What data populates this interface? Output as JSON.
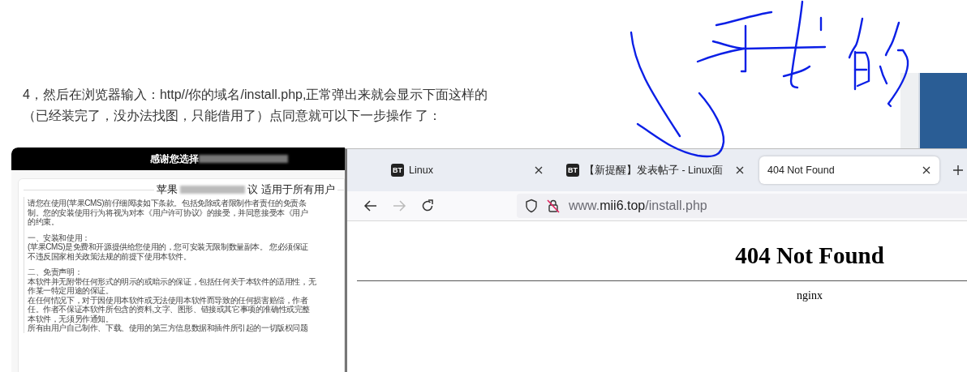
{
  "article": {
    "paragraph_lines": [
      "4，然后在浏览器输入：http//你的域名/install.php,正常弹出来就会显示下面这样的",
      "（已经装完了，没办法找图，只能借用了）点同意就可以下一步操作 了："
    ]
  },
  "embedded_screenshot": {
    "header_text": "感谢您选择",
    "title_start": "苹果",
    "title_end": "议 适用于所有用户",
    "body_blocks": [
      {
        "lines": [
          "请您在使用(苹果CMS)前仔细阅读如下条款。包括免除或者限制作者责任的免责条",
          "制。您的安装使用行为将视为对本《用户许可协议》的接受，并同意接受本《用户",
          "的约束。"
        ]
      },
      {
        "lines": [
          "一、安装和使用：",
          "(苹果CMS)是免费和开源提供给您使用的，您可安装无限制数量副本。 您必须保证",
          "不违反国家相关政策法规的前提下使用本软件。"
        ]
      },
      {
        "lines": [
          "二、免责声明：",
          "本软件并无附带任何形式的明示的或暗示的保证，包括任何关于本软件的适用性，无",
          "作某一特定用途的保证。",
          "在任何情况下，对于因使用本软件或无法使用本软件而导致的任何损害赔偿，作者",
          "任。作者不保证本软件所包含的资料,文字、图形、链接或其它事项的准确性或完整",
          "本软件，无须另作通知。",
          "所有由用户自己制作、下载、使用的第三方信息数据和插件所引起的一切版权问题"
        ]
      }
    ]
  },
  "browser": {
    "tabs": [
      {
        "favicon": "BT",
        "title": "Linux",
        "selected": false
      },
      {
        "favicon": "BT",
        "title": "【新提醒】发表帖子 - Linux面",
        "selected": false
      },
      {
        "title": "404 Not Found",
        "selected": true
      }
    ],
    "navigation": {
      "back_disabled": false,
      "forward_disabled": true
    },
    "address": {
      "prefix": "www.",
      "host": "mii6.top",
      "path": "/install.php"
    },
    "page": {
      "heading": "404 Not Found",
      "footer": "nginx"
    }
  }
}
